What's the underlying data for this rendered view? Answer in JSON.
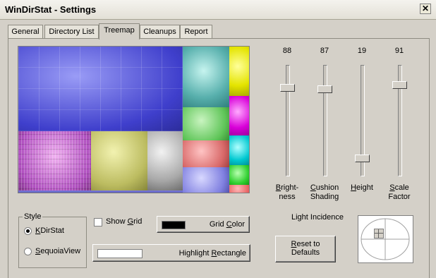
{
  "window": {
    "title": "WinDirStat - Settings",
    "close_glyph": "✕"
  },
  "tabs": [
    {
      "label": "General"
    },
    {
      "label": "Directory List"
    },
    {
      "label": "Treemap"
    },
    {
      "label": "Cleanups"
    },
    {
      "label": "Report"
    }
  ],
  "active_tab": "Treemap",
  "sliders": [
    {
      "value": "88",
      "label_line1": "Bright-",
      "label_line2": "ness",
      "level": 0.88
    },
    {
      "value": "87",
      "label_line1": "Cushion",
      "label_line2": "Shading",
      "level": 0.87
    },
    {
      "value": "19",
      "label_line1": "Height",
      "label_line2": "",
      "level": 0.19
    },
    {
      "value": "91",
      "label_line1": "Scale",
      "label_line2": "Factor",
      "level": 0.91
    }
  ],
  "style_group": {
    "legend": "Style",
    "options": [
      {
        "label": "KDirStat",
        "selected": true
      },
      {
        "label": "SequoiaView",
        "selected": false
      }
    ]
  },
  "show_grid": {
    "label": "Show Grid",
    "checked": false
  },
  "grid_color": {
    "label": "Grid Color",
    "swatch_color": "#000000"
  },
  "highlight_rectangle": {
    "label": "Highlight Rectangle",
    "swatch_color": "#ffffff"
  },
  "reset_button": {
    "line1": "Reset to",
    "line2": "Defaults"
  },
  "light_incidence": {
    "label": "Light Incidence"
  }
}
